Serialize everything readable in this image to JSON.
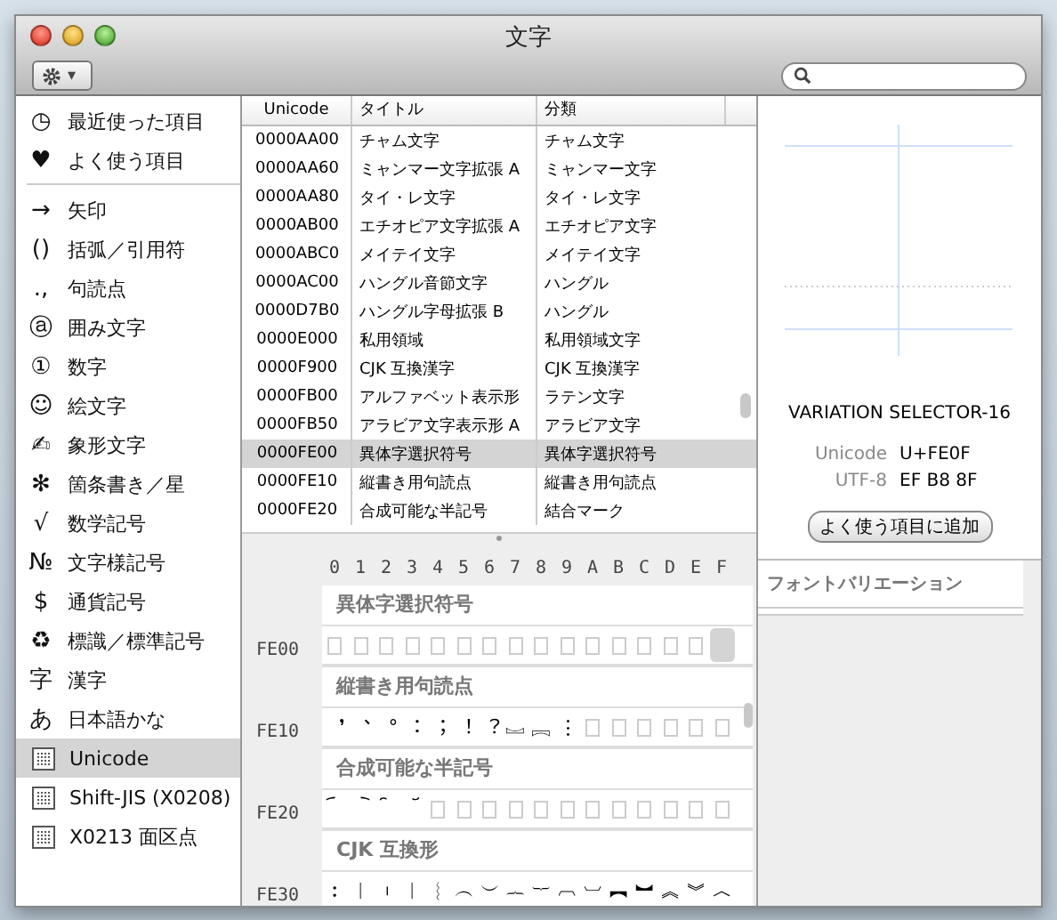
{
  "window": {
    "title": "文字"
  },
  "toolbar": {
    "action_menu": {
      "caret": "▾"
    }
  },
  "sidebar": {
    "sections": [
      {
        "items": [
          {
            "icon": "◷",
            "label": "最近使った項目",
            "kind": "glyph",
            "selected": false
          },
          {
            "icon": "♥",
            "label": "よく使う項目",
            "kind": "glyph",
            "selected": false
          }
        ]
      },
      {
        "items": [
          {
            "icon": "→",
            "label": "矢印",
            "kind": "glyph",
            "selected": false
          },
          {
            "icon": "()",
            "label": "括弧／引用符",
            "kind": "glyph",
            "selected": false
          },
          {
            "icon": ".,",
            "label": "句読点",
            "kind": "glyph",
            "selected": false
          },
          {
            "icon": "ⓐ",
            "label": "囲み文字",
            "kind": "glyph",
            "selected": false
          },
          {
            "icon": "①",
            "label": "数字",
            "kind": "glyph",
            "selected": false
          },
          {
            "icon": "☺",
            "label": "絵文字",
            "kind": "glyph",
            "selected": false
          },
          {
            "icon": "✍",
            "label": "象形文字",
            "kind": "glyph",
            "selected": false
          },
          {
            "icon": "✻",
            "label": "箇条書き／星",
            "kind": "glyph",
            "selected": false
          },
          {
            "icon": "√",
            "label": "数学記号",
            "kind": "glyph",
            "selected": false
          },
          {
            "icon": "№",
            "label": "文字様記号",
            "kind": "glyph",
            "selected": false
          },
          {
            "icon": "$",
            "label": "通貨記号",
            "kind": "glyph",
            "selected": false
          },
          {
            "icon": "♻",
            "label": "標識／標準記号",
            "kind": "glyph",
            "selected": false
          },
          {
            "icon": "字",
            "label": "漢字",
            "kind": "glyph",
            "selected": false
          },
          {
            "icon": "あ",
            "label": "日本語かな",
            "kind": "glyph",
            "selected": false
          },
          {
            "label": "Unicode",
            "kind": "grid",
            "selected": true
          },
          {
            "label": "Shift-JIS (X0208)",
            "kind": "grid",
            "selected": false
          },
          {
            "label": "X0213 面区点",
            "kind": "grid",
            "selected": false
          }
        ]
      }
    ]
  },
  "table": {
    "columns": [
      "Unicode",
      "タイトル",
      "分類"
    ],
    "rows": [
      {
        "cells": [
          "0000AA00",
          "チャム文字",
          "チャム文字"
        ],
        "selected": false
      },
      {
        "cells": [
          "0000AA60",
          "ミャンマー文字拡張 A",
          "ミャンマー文字"
        ],
        "selected": false
      },
      {
        "cells": [
          "0000AA80",
          "タイ・レ文字",
          "タイ・レ文字"
        ],
        "selected": false
      },
      {
        "cells": [
          "0000AB00",
          "エチオピア文字拡張 A",
          "エチオピア文字"
        ],
        "selected": false
      },
      {
        "cells": [
          "0000ABC0",
          "メイテイ文字",
          "メイテイ文字"
        ],
        "selected": false
      },
      {
        "cells": [
          "0000AC00",
          "ハングル音節文字",
          "ハングル"
        ],
        "selected": false
      },
      {
        "cells": [
          "0000D7B0",
          "ハングル字母拡張 B",
          "ハングル"
        ],
        "selected": false
      },
      {
        "cells": [
          "0000E000",
          "私用領域",
          "私用領域文字"
        ],
        "selected": false
      },
      {
        "cells": [
          "0000F900",
          "CJK 互換漢字",
          "CJK 互換漢字"
        ],
        "selected": false
      },
      {
        "cells": [
          "0000FB00",
          "アルファベット表示形",
          "ラテン文字"
        ],
        "selected": false
      },
      {
        "cells": [
          "0000FB50",
          "アラビア文字表示形 A",
          "アラビア文字"
        ],
        "selected": false
      },
      {
        "cells": [
          "0000FE00",
          "異体字選択符号",
          "異体字選択符号"
        ],
        "selected": true
      },
      {
        "cells": [
          "0000FE10",
          "縦書き用句読点",
          "縦書き用句読点"
        ],
        "selected": false
      },
      {
        "cells": [
          "0000FE20",
          "合成可能な半記号",
          "結合マーク"
        ],
        "selected": false
      }
    ]
  },
  "grid": {
    "columns": [
      "0",
      "1",
      "2",
      "3",
      "4",
      "5",
      "6",
      "7",
      "8",
      "9",
      "A",
      "B",
      "C",
      "D",
      "E",
      "F"
    ],
    "blocks": [
      {
        "title": "異体字選択符号",
        "row_label": "FE00",
        "cells": [
          {
            "kind": "missing",
            "selected": false
          },
          {
            "kind": "missing",
            "selected": false
          },
          {
            "kind": "missing",
            "selected": false
          },
          {
            "kind": "missing",
            "selected": false
          },
          {
            "kind": "missing",
            "selected": false
          },
          {
            "kind": "missing",
            "selected": false
          },
          {
            "kind": "missing",
            "selected": false
          },
          {
            "kind": "missing",
            "selected": false
          },
          {
            "kind": "missing",
            "selected": false
          },
          {
            "kind": "missing",
            "selected": false
          },
          {
            "kind": "missing",
            "selected": false
          },
          {
            "kind": "missing",
            "selected": false
          },
          {
            "kind": "missing",
            "selected": false
          },
          {
            "kind": "missing",
            "selected": false
          },
          {
            "kind": "missing",
            "selected": false
          },
          {
            "kind": "blank",
            "selected": true
          }
        ]
      },
      {
        "title": "縦書き用句読点",
        "row_label": "FE10",
        "cells": [
          {
            "kind": "glyph",
            "char": "︐",
            "selected": false
          },
          {
            "kind": "glyph",
            "char": "︑",
            "selected": false
          },
          {
            "kind": "glyph",
            "char": "︒",
            "selected": false
          },
          {
            "kind": "glyph",
            "char": "︓",
            "selected": false
          },
          {
            "kind": "glyph",
            "char": "︔",
            "selected": false
          },
          {
            "kind": "glyph",
            "char": "︕",
            "selected": false
          },
          {
            "kind": "glyph",
            "char": "︖",
            "selected": false
          },
          {
            "kind": "glyph",
            "char": "︗",
            "selected": false
          },
          {
            "kind": "glyph",
            "char": "︘",
            "selected": false
          },
          {
            "kind": "glyph",
            "char": "︙",
            "selected": false
          },
          {
            "kind": "missing",
            "selected": false
          },
          {
            "kind": "missing",
            "selected": false
          },
          {
            "kind": "missing",
            "selected": false
          },
          {
            "kind": "missing",
            "selected": false
          },
          {
            "kind": "missing",
            "selected": false
          },
          {
            "kind": "missing",
            "selected": false
          }
        ]
      },
      {
        "title": "合成可能な半記号",
        "row_label": "FE20",
        "cells": [
          {
            "kind": "glyph",
            "char": "︠",
            "selected": false
          },
          {
            "kind": "glyph",
            "char": "︡",
            "selected": false
          },
          {
            "kind": "glyph",
            "char": "︢",
            "selected": false
          },
          {
            "kind": "glyph",
            "char": "︣",
            "selected": false
          },
          {
            "kind": "missing",
            "selected": false
          },
          {
            "kind": "missing",
            "selected": false
          },
          {
            "kind": "missing",
            "selected": false
          },
          {
            "kind": "missing",
            "selected": false
          },
          {
            "kind": "missing",
            "selected": false
          },
          {
            "kind": "missing",
            "selected": false
          },
          {
            "kind": "missing",
            "selected": false
          },
          {
            "kind": "missing",
            "selected": false
          },
          {
            "kind": "missing",
            "selected": false
          },
          {
            "kind": "missing",
            "selected": false
          },
          {
            "kind": "missing",
            "selected": false
          },
          {
            "kind": "missing",
            "selected": false
          }
        ]
      },
      {
        "title": "CJK 互換形",
        "row_label": "FE30",
        "cells": [
          {
            "kind": "glyph",
            "char": "︰",
            "selected": false
          },
          {
            "kind": "glyph",
            "char": "︱",
            "selected": false
          },
          {
            "kind": "glyph",
            "char": "︲",
            "selected": false
          },
          {
            "kind": "glyph",
            "char": "︳",
            "selected": false
          },
          {
            "kind": "glyph",
            "char": "︴",
            "selected": false
          },
          {
            "kind": "glyph",
            "char": "︵",
            "selected": false
          },
          {
            "kind": "glyph",
            "char": "︶",
            "selected": false
          },
          {
            "kind": "glyph",
            "char": "︷",
            "selected": false
          },
          {
            "kind": "glyph",
            "char": "︸",
            "selected": false
          },
          {
            "kind": "glyph",
            "char": "︹",
            "selected": false
          },
          {
            "kind": "glyph",
            "char": "︺",
            "selected": false
          },
          {
            "kind": "glyph",
            "char": "︻",
            "selected": false
          },
          {
            "kind": "glyph",
            "char": "︼",
            "selected": false
          },
          {
            "kind": "glyph",
            "char": "︽",
            "selected": false
          },
          {
            "kind": "glyph",
            "char": "︾",
            "selected": false
          },
          {
            "kind": "glyph",
            "char": "︿",
            "selected": false
          }
        ]
      }
    ]
  },
  "detail": {
    "name": "VARIATION SELECTOR-16",
    "codes": [
      {
        "label": "Unicode",
        "value": "U+FE0F"
      },
      {
        "label": "UTF-8",
        "value": "EF B8 8F"
      }
    ],
    "add_button": "よく使う項目に追加"
  },
  "font_variation": {
    "title": "フォントバリエーション"
  }
}
